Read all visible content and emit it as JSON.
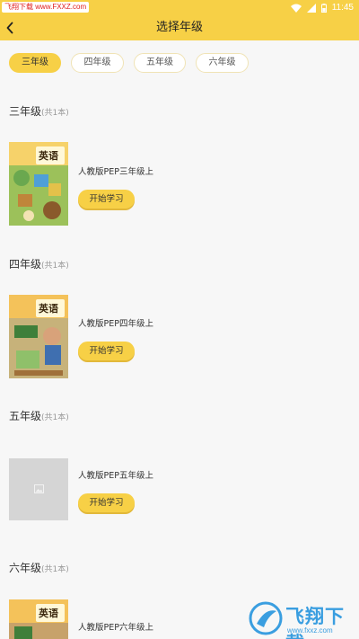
{
  "status_bar": {
    "left_text": "飞翔下载 www.FXXZ.com",
    "time": "11:45"
  },
  "header": {
    "title": "选择年级"
  },
  "tabs": [
    {
      "label": "三年级",
      "active": true
    },
    {
      "label": "四年级",
      "active": false
    },
    {
      "label": "五年级",
      "active": false
    },
    {
      "label": "六年级",
      "active": false
    }
  ],
  "sections": [
    {
      "grade": "三年级",
      "count": "(共1本)",
      "book_name": "人教版PEP三年级上",
      "button": "开始学习",
      "cover_title": "英语"
    },
    {
      "grade": "四年级",
      "count": "(共1本)",
      "book_name": "人教版PEP四年级上",
      "button": "开始学习",
      "cover_title": "英语"
    },
    {
      "grade": "五年级",
      "count": "(共1本)",
      "book_name": "人教版PEP五年级上",
      "button": "开始学习"
    },
    {
      "grade": "六年级",
      "count": "(共1本)",
      "book_name": "人教版PEP六年级上",
      "cover_title": "英语"
    }
  ],
  "watermark": {
    "text": "飞翔下载",
    "sub": "www.fxxz.com"
  },
  "colors": {
    "accent": "#f7d046",
    "page_bg": "#f7f7f7"
  }
}
